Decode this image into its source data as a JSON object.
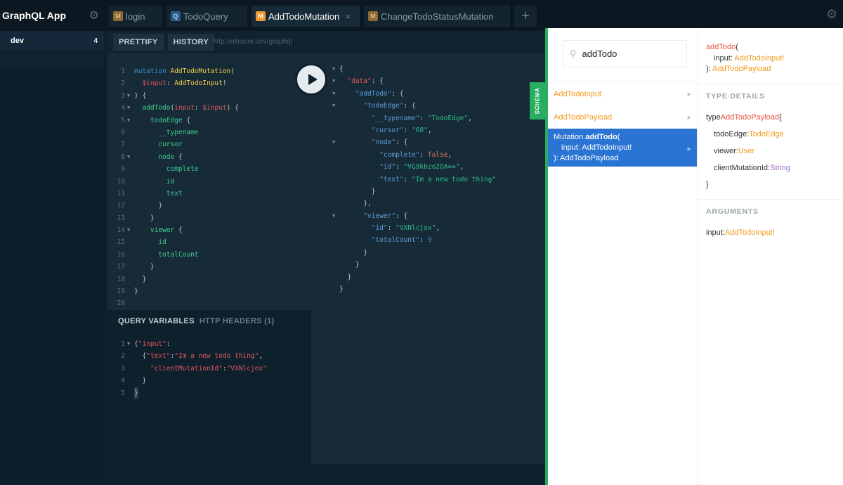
{
  "sidebar": {
    "app_title": "GraphQL App",
    "env_name": "dev",
    "env_count": "4"
  },
  "tabs": [
    {
      "badge": "M",
      "label": "login"
    },
    {
      "badge": "Q",
      "label": "TodoQuery"
    },
    {
      "badge": "M",
      "label": "AddTodoMutation",
      "close": "×"
    },
    {
      "badge": "M",
      "label": "ChangeTodoStatusMutation"
    }
  ],
  "toolbar": {
    "prettify": "PRETTIFY",
    "history": "HISTORY",
    "url": "http://altraser.dev/graphql"
  },
  "query_lines": [
    "1",
    "2",
    "3",
    "4",
    "5",
    "6",
    "7",
    "8",
    "9",
    "10",
    "11",
    "12",
    "13",
    "14",
    "15",
    "16",
    "17",
    "18",
    "19",
    "20"
  ],
  "query_text": {
    "l1a": "mutation ",
    "l1b": "AddTodoMutation",
    "l1c": "(",
    "l2a": "$input",
    "l2b": ": ",
    "l2c": "AddTodoInput",
    "l2d": "!",
    "l3": ") {",
    "l4a": "addTodo",
    "l4b": "(",
    "l4c": "input",
    "l4d": ": ",
    "l4e": "$input",
    "l4f": ") {",
    "l5a": "todoEdge",
    "l5b": " {",
    "l6": "__typename",
    "l7": "cursor",
    "l8a": "node",
    "l8b": " {",
    "l9": "complete",
    "l10": "id",
    "l11": "text",
    "l12": "}",
    "l13": "}",
    "l14a": "viewer",
    "l14b": " {",
    "l15": "id",
    "l16": "totalCount",
    "l17": "}",
    "l18": "}",
    "l19": "}"
  },
  "variables": {
    "tab_active": "QUERY VARIABLES",
    "tab_other": "HTTP HEADERS (1)",
    "v1a": "{",
    "v1b": "\"input\"",
    "v1c": ":",
    "v2a": "{",
    "v2b": "\"text\"",
    "v2c": ":",
    "v2d": "\"Im a new todo thing\"",
    "v2e": ",",
    "v3a": "\"clientMutationId\"",
    "v3b": ":",
    "v3c": "\"VXNlcjox\"",
    "v4": "}",
    "v5": "}"
  },
  "result": {
    "r1": "{",
    "r2a": "\"data\"",
    "r2b": ": {",
    "r3a": "\"addTodo\"",
    "r3b": ": {",
    "r4a": "\"todoEdge\"",
    "r4b": ": {",
    "r5a": "\"__typename\"",
    "r5b": ": ",
    "r5c": "\"TodoEdge\"",
    "r5d": ",",
    "r6a": "\"cursor\"",
    "r6b": ": ",
    "r6c": "\"68\"",
    "r6d": ",",
    "r7a": "\"node\"",
    "r7b": ": {",
    "r8a": "\"complete\"",
    "r8b": ": ",
    "r8c": "false",
    "r8d": ",",
    "r9a": "\"id\"",
    "r9b": ": ",
    "r9c": "\"VG9kbzo2OA==\"",
    "r9d": ",",
    "r10a": "\"text\"",
    "r10b": ": ",
    "r10c": "\"Im a new todo thing\"",
    "r11": "}",
    "r12": "},",
    "r13a": "\"viewer\"",
    "r13b": ": {",
    "r14a": "\"id\"",
    "r14b": ": ",
    "r14c": "\"VXNlcjox\"",
    "r14d": ",",
    "r15a": "\"totalCount\"",
    "r15b": ": ",
    "r15c": "9",
    "r16": "}",
    "r17": "}",
    "r18": "}",
    "r19": "}"
  },
  "schema": {
    "tab_label": "SCHEMA",
    "search_value": "addTodo",
    "list": [
      {
        "label": "AddTodoInput"
      },
      {
        "label": "AddTodoPayload"
      }
    ],
    "selected": {
      "line1a": "Mutation.",
      "line1b": "addTodo",
      "line1c": "(",
      "line2": "input: AddTodoInput!",
      "line3": "): AddTodoPayload"
    },
    "details": {
      "h1a": "addTodo",
      "h1b": "(",
      "h2a": "input",
      "h2b": ": ",
      "h2c": "AddTodoInput!",
      "h3a": "): ",
      "h3b": "AddTodoPayload",
      "type_details_label": "TYPE DETAILS",
      "type_kw": "type ",
      "type_name": "AddTodoPayload",
      "type_open": " {",
      "fields": [
        {
          "name": "todoEdge",
          "type": "TodoEdge"
        },
        {
          "name": "viewer",
          "type": "User"
        },
        {
          "name": "clientMutationId",
          "type": "String"
        }
      ],
      "type_close": "}",
      "arguments_label": "ARGUMENTS",
      "arg_name": "input",
      "arg_type": "AddTodoInput!"
    }
  },
  "icons": {
    "gear": "gear-icon",
    "play": "play-icon",
    "search": "search-icon",
    "plus": "plus-icon"
  }
}
